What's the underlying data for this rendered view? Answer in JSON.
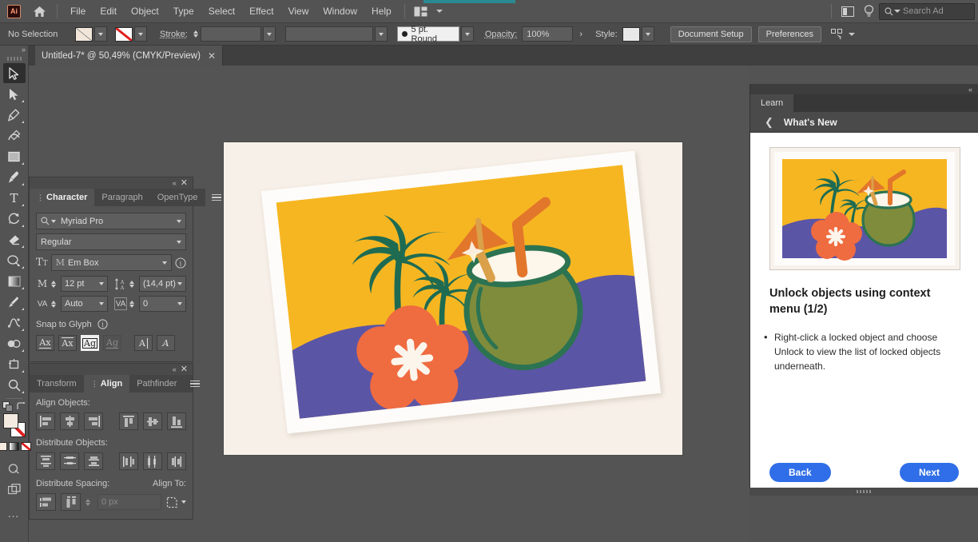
{
  "app": {
    "logo_text": "Ai",
    "home_icon": "home-icon",
    "arrange_icon": "arrange-documents-icon"
  },
  "menubar": {
    "items": [
      "File",
      "Edit",
      "Object",
      "Type",
      "Select",
      "Effect",
      "View",
      "Window",
      "Help"
    ],
    "right": {
      "properties_icon": "properties-panel-icon",
      "discover_icon": "lightbulb-discover-icon",
      "search_placeholder": "Search Ad",
      "search_icon": "search-icon"
    }
  },
  "controlbar": {
    "selection_status": "No Selection",
    "fill_swatch": "fill-swatch",
    "stroke_swatch": "stroke-none-swatch",
    "stroke_label": "Stroke:",
    "stroke_weight": "",
    "stroke_profile": "",
    "brush_definition": "5 pt. Round",
    "opacity_label": "Opacity:",
    "opacity_value": "100%",
    "style_label": "Style:",
    "document_setup": "Document Setup",
    "preferences": "Preferences",
    "select_similar_icon": "select-similar-objects-icon"
  },
  "document_tab": {
    "title": "Untitled-7* @ 50,49% (CMYK/Preview)",
    "close_icon": "close-icon"
  },
  "toolbar": {
    "tools": [
      {
        "name": "selection-tool",
        "glyph": "selection",
        "active": true,
        "corner": false
      },
      {
        "name": "direct-selection-tool",
        "glyph": "direct-selection",
        "active": false,
        "corner": true
      },
      {
        "name": "pen-tool",
        "glyph": "pen",
        "active": false,
        "corner": true
      },
      {
        "name": "curvature-tool",
        "glyph": "curvature",
        "active": false,
        "corner": false
      },
      {
        "name": "rectangle-tool",
        "glyph": "rectangle",
        "active": false,
        "corner": true
      },
      {
        "name": "paintbrush-tool",
        "glyph": "brush",
        "active": false,
        "corner": true
      },
      {
        "name": "type-tool",
        "glyph": "type",
        "active": false,
        "corner": true
      },
      {
        "name": "rotate-tool",
        "glyph": "rotate",
        "active": false,
        "corner": true
      },
      {
        "name": "eraser-tool",
        "glyph": "eraser",
        "active": false,
        "corner": true
      },
      {
        "name": "scale-tool",
        "glyph": "scale",
        "active": false,
        "corner": true
      },
      {
        "name": "gradient-tool",
        "glyph": "gradient",
        "active": false,
        "corner": true
      },
      {
        "name": "eyedropper-tool",
        "glyph": "eyedropper",
        "active": false,
        "corner": true
      },
      {
        "name": "blend-tool",
        "glyph": "blend",
        "active": false,
        "corner": true
      },
      {
        "name": "shape-builder-tool",
        "glyph": "shape-builder",
        "active": false,
        "corner": true
      },
      {
        "name": "artboard-tool",
        "glyph": "artboard",
        "active": false,
        "corner": true
      },
      {
        "name": "zoom-tool",
        "glyph": "zoom",
        "active": false,
        "corner": true
      }
    ],
    "swap_fill_stroke_icon": "swap-fill-stroke-icon",
    "default_fill_stroke_icon": "default-fill-stroke-icon",
    "fill_color": "#f4eadf",
    "stroke_color": "none",
    "color_modes": [
      "color-mode-icon",
      "gradient-mode-icon",
      "none-mode-icon"
    ],
    "screen_mode_icon": "change-screen-mode-icon",
    "edit_toolbar_icon": "edit-toolbar-ellipsis-icon"
  },
  "character_panel": {
    "tabs": [
      {
        "label": "Character",
        "active": true
      },
      {
        "label": "Paragraph",
        "active": false
      },
      {
        "label": "OpenType",
        "active": false
      }
    ],
    "menu_icon": "panel-menu-icon",
    "font_family": "Myriad Pro",
    "font_style": "Regular",
    "font_metric_label": "Em Box",
    "font_size": "12 pt",
    "leading": "(14,4 pt)",
    "kerning": "Auto",
    "tracking": "0",
    "snap_to_glyph_label": "Snap to Glyph",
    "info_icon": "info-icon",
    "snap_buttons": [
      {
        "name": "snap-baseline",
        "label": "Ax",
        "state": "normal"
      },
      {
        "name": "snap-x-height",
        "label": "Ax",
        "state": "normal"
      },
      {
        "name": "snap-em-box",
        "label": "Ag",
        "state": "selected"
      },
      {
        "name": "snap-descender",
        "label": "Ag",
        "state": "disabled"
      },
      {
        "name": "snap-slant-left",
        "label": "A",
        "state": "normal"
      },
      {
        "name": "snap-slant-right",
        "label": "A",
        "state": "normal"
      }
    ]
  },
  "align_panel": {
    "tabs": [
      {
        "label": "Transform",
        "active": false
      },
      {
        "label": "Align",
        "active": true
      },
      {
        "label": "Pathfinder",
        "active": false
      }
    ],
    "menu_icon": "panel-menu-icon",
    "align_objects_label": "Align Objects:",
    "align_buttons": [
      "align-left-icon",
      "align-horizontal-center-icon",
      "align-right-icon",
      "align-top-icon",
      "align-vertical-center-icon",
      "align-bottom-icon"
    ],
    "distribute_objects_label": "Distribute Objects:",
    "distribute_buttons": [
      "distribute-vertical-top-icon",
      "distribute-vertical-center-icon",
      "distribute-vertical-bottom-icon",
      "distribute-horizontal-left-icon",
      "distribute-horizontal-center-icon",
      "distribute-horizontal-right-icon"
    ],
    "distribute_spacing_label": "Distribute Spacing:",
    "spacing_buttons": [
      "distribute-vertical-space-icon",
      "distribute-horizontal-space-icon"
    ],
    "spacing_value": "0 px",
    "align_to_label": "Align To:",
    "align_to_icon": "align-to-selection-icon"
  },
  "learn_panel": {
    "tab_label": "Learn",
    "back_icon": "back-chevron-icon",
    "header": "What's New",
    "collapse_icon": "collapse-panel-icon",
    "lesson_title": "Unlock objects using context menu (1/2)",
    "lesson_bullet": "Right-click a locked object and choose Unlock to view the list of locked objects underneath.",
    "back_button": "Back",
    "next_button": "Next",
    "thumbnail_name": "tropical-coconut-illustration-thumbnail"
  },
  "artwork": {
    "name": "tropical-coconut-beach-illustration",
    "colors": {
      "canvas_bg": "#f7f0e8",
      "polaroid": "#fdfcfa",
      "sky": "#f6b622",
      "sea": "#5b55a6",
      "palm": "#1e6b52",
      "flower": "#ef6b40",
      "flower_center": "#fbf5ec",
      "coconut": "#7f8c3c",
      "coconut_outline": "#2c7352",
      "coconut_milk": "#fdf6ea",
      "umbrella": "#e2762a",
      "straw": "#e2762a",
      "straw_light": "#dba04a"
    }
  }
}
